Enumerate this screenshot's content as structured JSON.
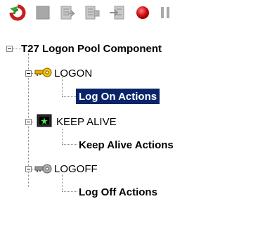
{
  "toolbar": {
    "buttons": [
      {
        "name": "refresh-icon",
        "label": ""
      },
      {
        "name": "stop-square-icon",
        "label": ""
      },
      {
        "name": "export-list-icon",
        "label": ""
      },
      {
        "name": "import-list-icon",
        "label": ""
      },
      {
        "name": "step-into-icon",
        "label": ""
      },
      {
        "name": "record-icon",
        "label": ""
      },
      {
        "name": "pause-icon",
        "label": ""
      }
    ]
  },
  "tree": {
    "root_label": "T27 Logon Pool Component",
    "nodes": [
      {
        "label": "LOGON",
        "icon": "key-icon",
        "child": "Log On Actions",
        "selected": true
      },
      {
        "label": "KEEP ALIVE",
        "icon": "monitor-icon",
        "child": "Keep Alive Actions",
        "selected": false
      },
      {
        "label": "LOGOFF",
        "icon": "key-gray-icon",
        "child": "Log Off Actions",
        "selected": false
      }
    ]
  },
  "colors": {
    "selection_bg": "#0a246a",
    "selection_fg": "#ffffff"
  }
}
